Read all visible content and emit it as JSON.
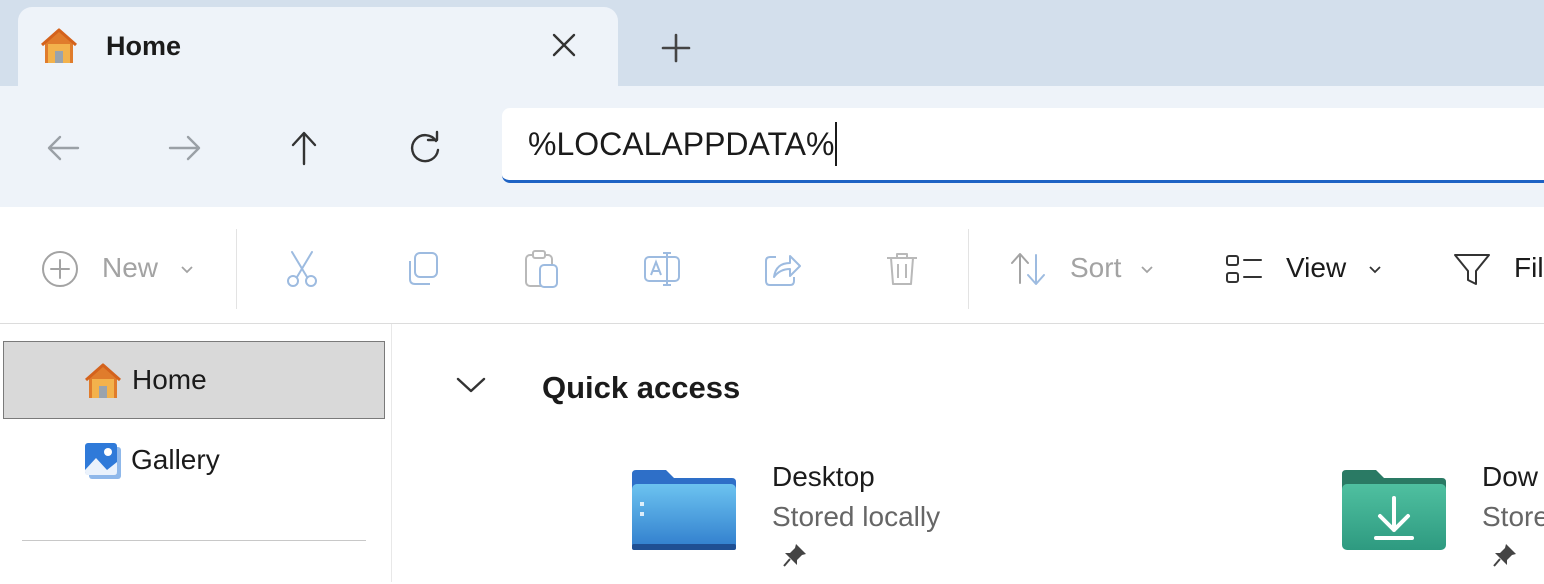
{
  "tab": {
    "title": "Home",
    "icon": "home-icon",
    "close_icon": "close-icon",
    "new_tab_icon": "plus-icon"
  },
  "nav": {
    "back_icon": "arrow-left-icon",
    "forward_icon": "arrow-right-icon",
    "up_icon": "arrow-up-icon",
    "refresh_icon": "refresh-icon"
  },
  "address": {
    "value": "%LOCALAPPDATA%"
  },
  "toolbar": {
    "new_label": "New",
    "sort_label": "Sort",
    "view_label": "View",
    "filter_label": "Fil",
    "icons": [
      "plus-circle-icon",
      "cut-icon",
      "copy-icon",
      "paste-icon",
      "rename-icon",
      "share-icon",
      "delete-icon",
      "sort-icon",
      "view-icon",
      "filter-icon"
    ]
  },
  "sidebar": {
    "items": [
      {
        "label": "Home",
        "icon": "home-icon",
        "selected": true
      },
      {
        "label": "Gallery",
        "icon": "gallery-icon",
        "selected": false
      }
    ]
  },
  "main": {
    "section_title": "Quick access",
    "items": [
      {
        "name": "Desktop",
        "status": "Stored locally",
        "icon": "desktop-folder-icon",
        "color": "#3a8fd9"
      },
      {
        "name": "Dow",
        "status": "Store",
        "icon": "downloads-folder-icon",
        "color": "#3aa58a"
      }
    ]
  },
  "colors": {
    "accent": "#1d62c4",
    "tab_strip": "#d3dfec",
    "nav_bg": "#eef3f9",
    "selected_bg": "#d9d9d9"
  }
}
